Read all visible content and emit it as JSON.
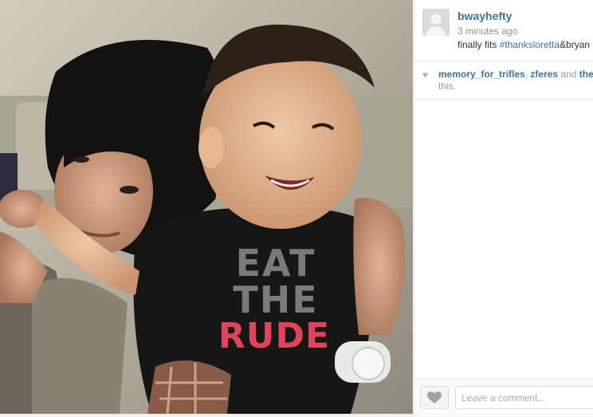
{
  "post": {
    "username": "bwayhefty",
    "timestamp": "3 minutes ago",
    "caption_before": "finally fits ",
    "hashtag": "#thankslorettа",
    "caption_after": "&bryan"
  },
  "likes": {
    "liker1": "memory_for_trifles",
    "sep": ", ",
    "liker2": "zferes",
    "and": " and ",
    "liker3": "thest",
    "line2": "this."
  },
  "photo": {
    "shirt_line1": "EAT",
    "shirt_line2": "THE",
    "shirt_line3": "RUDE"
  },
  "comment": {
    "placeholder": "Leave a comment..."
  },
  "colors": {
    "link": "#3f729b",
    "shirt_accent": "#e0445a"
  }
}
